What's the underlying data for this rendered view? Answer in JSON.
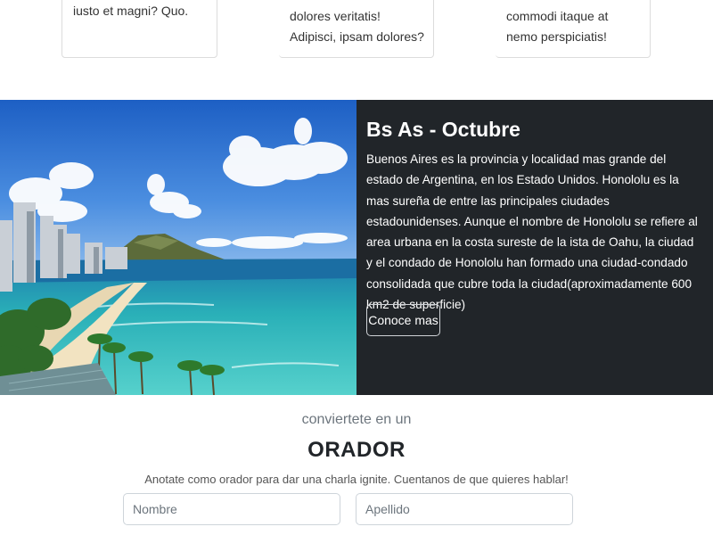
{
  "cards": [
    {
      "text": "iusto et magni? Quo."
    },
    {
      "text": "dolores veritatis! Adipisci, ipsam dolores?"
    },
    {
      "text": "commodi itaque at nemo perspiciatis!"
    }
  ],
  "hero": {
    "title": "Bs As - Octubre",
    "description": "Buenos Aires es la provincia y localidad mas grande del estado de Argentina, en los Estado Unidos. Honololu es la mas sureña de entre las principales ciudades estadounidenses. Aunque el nombre de Honololu se refiere al area urbana en la costa sureste de la ista de Oahu, la ciudad y el condado de Honololu han formado una ciudad-condado consolidada que cubre toda la ciudad(aproximadamente 600 km2 de superficie)",
    "button_label": "Conoce mas"
  },
  "orador": {
    "pretitle": "conviertete en un",
    "title": "ORADOR",
    "subtitle": "Anotate como orador para dar una charla ignite. Cuentanos de que quieres hablar!",
    "nombre_placeholder": "Nombre",
    "apellido_placeholder": "Apellido"
  },
  "colors": {
    "hero_bg": "#212529",
    "text_muted": "#6c757d"
  }
}
